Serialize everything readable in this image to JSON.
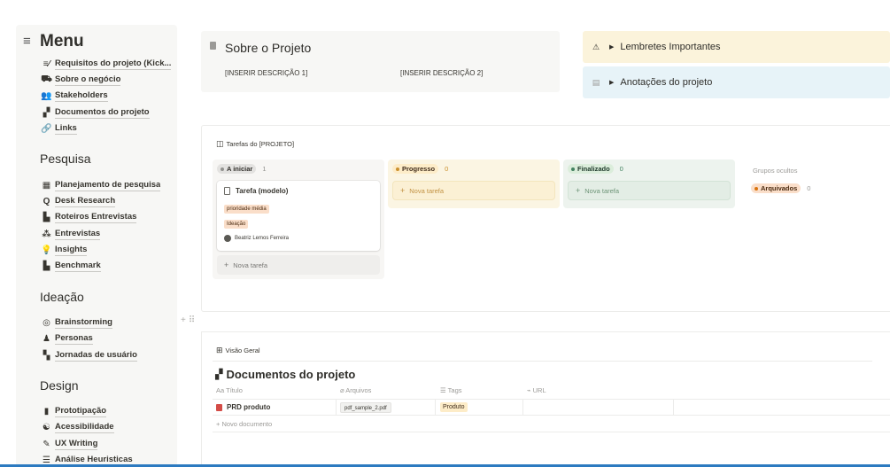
{
  "sidebar": {
    "menu_title": "Menu",
    "menu_icon": "≡",
    "items": [
      {
        "icon": "≡⁄",
        "label": "Requisitos do projeto (Kick..."
      },
      {
        "icon": "⛟",
        "label": "Sobre o negócio"
      },
      {
        "icon": "👥",
        "label": "Stakeholders"
      },
      {
        "icon": "▞",
        "label": "Documentos do projeto"
      },
      {
        "icon": "🔗",
        "label": "Links"
      }
    ],
    "sections": [
      {
        "title": "Pesquisa",
        "items": [
          {
            "icon": "▦",
            "label": "Planejamento de pesquisa"
          },
          {
            "icon": "Q",
            "label": "Desk Research"
          },
          {
            "icon": "▙",
            "label": "Roteiros Entrevistas"
          },
          {
            "icon": "⁂",
            "label": "Entrevistas"
          },
          {
            "icon": "💡",
            "label": "Insights"
          },
          {
            "icon": "▙",
            "label": "Benchmark"
          }
        ]
      },
      {
        "title": "Ideação",
        "items": [
          {
            "icon": "◎",
            "label": "Brainstorming"
          },
          {
            "icon": "♟",
            "label": "Personas"
          },
          {
            "icon": "▚",
            "label": "Jornadas de usuário"
          }
        ]
      },
      {
        "title": "Design",
        "items": [
          {
            "icon": "▮",
            "label": "Prototipação"
          },
          {
            "icon": "☯",
            "label": "Acessibilidade"
          },
          {
            "icon": "✎",
            "label": "UX Writing"
          },
          {
            "icon": "☰",
            "label": "Análise Heuristicas"
          }
        ]
      }
    ]
  },
  "sobre": {
    "title": "Sobre o Projeto",
    "desc1": "[INSERIR DESCRIÇÃO 1]",
    "desc2": "[INSERIR DESCRIÇÃO 2]"
  },
  "callouts": {
    "lembretes": "Lembretes Importantes",
    "lembretes_icon": "⚠",
    "anotacoes": "Anotações do projeto",
    "anotacoes_icon": "▤",
    "toggle_icon": "▶"
  },
  "board": {
    "title": "Tarefas do [PROJETO]",
    "columns": {
      "todo": {
        "label": "A iniciar",
        "count": "1",
        "color": "#91918e",
        "bg": "#e3e2e0"
      },
      "prog": {
        "label": "Progresso",
        "count": "0",
        "color": "#cb912f",
        "bg": "#fdecc8"
      },
      "done": {
        "label": "Finalizado",
        "count": "0",
        "color": "#448361",
        "bg": "#dbeddb"
      }
    },
    "card": {
      "title": "Tarefa (modelo)",
      "tag1": "prioridade média",
      "tag2": "Ideação",
      "person": "Beatriz Lemos Ferreira"
    },
    "new_task": "Nova tarefa",
    "hidden_groups": "Grupos ocultos",
    "archived": {
      "label": "Arquivados",
      "count": "0"
    }
  },
  "visao": {
    "title": "Visão Geral",
    "db_title": "Documentos do projeto",
    "headers": {
      "titulo": "Aa Título",
      "arquivos": "Arquivos",
      "tags": "Tags",
      "url": "URL"
    },
    "row": {
      "name": "PRD produto",
      "file": "pdf_sample_2.pdf",
      "tag": "Produto"
    },
    "new_doc": "Novo documento"
  }
}
